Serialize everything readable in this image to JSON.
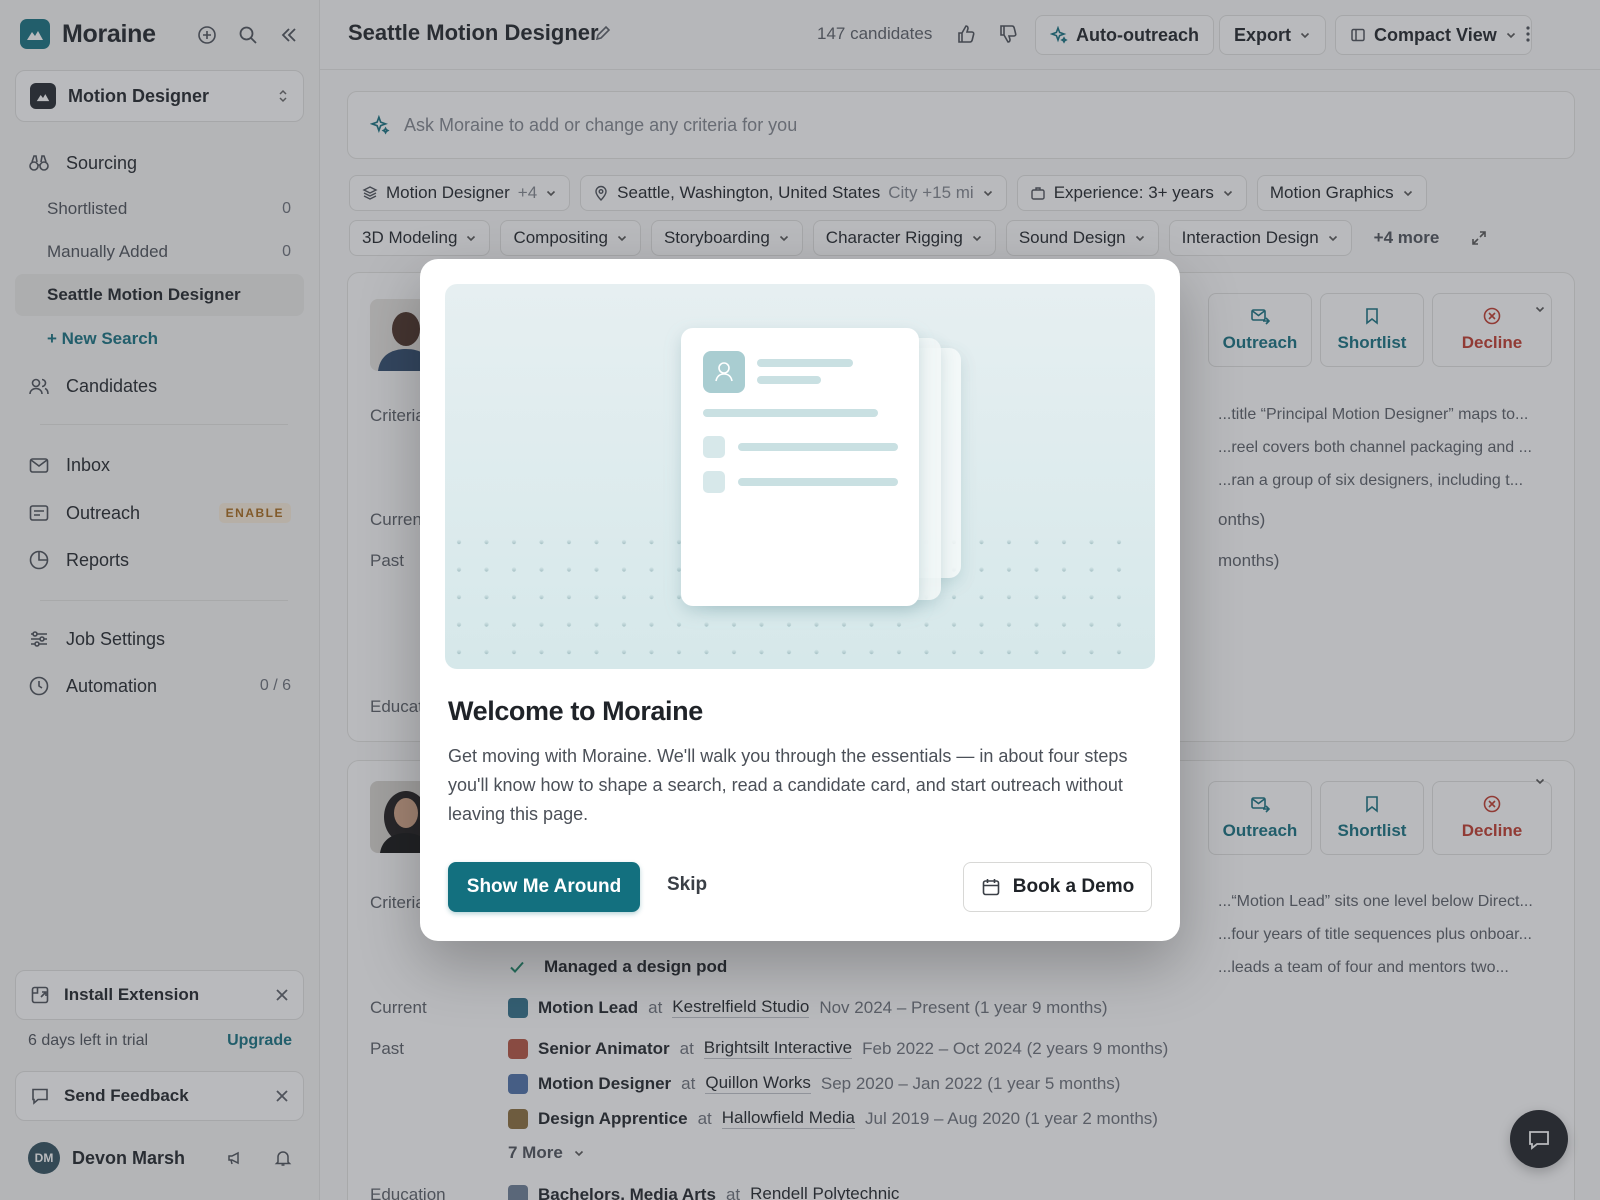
{
  "app": {
    "name": "Moraine"
  },
  "sidebar": {
    "job": "Motion Designer",
    "sourcing": "Sourcing",
    "sub_items": [
      {
        "label": "Shortlisted",
        "count": "0"
      },
      {
        "label": "Manually Added",
        "count": "0"
      },
      {
        "label": "Seattle Motion Designer",
        "count": ""
      }
    ],
    "new_search": "+ New Search",
    "candidates": "Candidates",
    "inbox": "Inbox",
    "outreach": "Outreach",
    "outreach_badge": "ENABLE",
    "reports": "Reports",
    "job_settings": "Job Settings",
    "automation": "Automation",
    "automation_count": "0 / 6",
    "install_extension": "Install Extension",
    "trial_text": "6 days left in trial",
    "upgrade": "Upgrade",
    "send_feedback": "Send Feedback",
    "user": {
      "initials": "DM",
      "name": "Devon Marsh"
    }
  },
  "header": {
    "title": "Seattle Motion Designer",
    "candidate_count": "147 candidates",
    "auto_outreach": "Auto-outreach",
    "export": "Export",
    "view": "Compact View"
  },
  "ask": {
    "placeholder": "Ask Moraine to add or change any criteria for you"
  },
  "filters": {
    "role": {
      "label": "Motion Designer",
      "extra": "+4"
    },
    "location": {
      "label": "Seattle, Washington, United States",
      "extra": "City +15 mi"
    },
    "experience": "Experience: 3+ years",
    "skills": [
      "Motion Graphics",
      "3D Modeling",
      "Compositing",
      "Storyboarding",
      "Character Rigging",
      "Sound Design",
      "Interaction Design"
    ],
    "more": "+4 more"
  },
  "card1": {
    "labels": {
      "criteria": "Criteria",
      "current": "Current",
      "past": "Past",
      "education": "Education"
    },
    "criteria_snippets": [
      "...title “Principal Motion Designer” maps to...",
      "...reel covers both channel packaging and ...",
      "...ran a group of six designers, including t..."
    ],
    "current_tail": "onths)",
    "past_tail": "months)"
  },
  "card2": {
    "labels": {
      "criteria": "Criteria",
      "current": "Current",
      "past": "Past",
      "education": "Education"
    },
    "criteria_snippets": [
      "...“Motion Lead” sits one level below Direct...",
      "...four years of title sequences plus onboar...",
      "...leads a team of four and mentors two..."
    ],
    "criteria_met": "Managed a design pod",
    "current": {
      "role": "Motion Lead",
      "at": "at",
      "company": "Kestrelfield Studio",
      "dates": "Nov 2024 – Present (1 year 9 months)"
    },
    "past": [
      {
        "role": "Senior Animator",
        "at": "at",
        "company": "Brightsilt Interactive",
        "dates": "Feb 2022 – Oct 2024 (2 years 9 months)"
      },
      {
        "role": "Motion Designer",
        "at": "at",
        "company": "Quillon Works",
        "dates": "Sep 2020 – Jan 2022 (1 year 5 months)"
      },
      {
        "role": "Design Apprentice",
        "at": "at",
        "company": "Hallowfield Media",
        "dates": "Jul 2019 – Aug 2020 (1 year 2 months)"
      }
    ],
    "more": "7 More",
    "education": {
      "degree": "Bachelors, Media Arts",
      "at": "at",
      "school": "Rendell Polytechnic"
    }
  },
  "actions": {
    "outreach": "Outreach",
    "shortlist": "Shortlist",
    "decline": "Decline"
  },
  "modal": {
    "title": "Welcome to Moraine",
    "body": "Get moving with Moraine. We'll walk you through the essentials — in about four steps you'll know how to shape a search, read a candidate card, and start outreach without leaving this page.",
    "primary": "Show Me Around",
    "skip": "Skip",
    "demo": "Book a Demo"
  },
  "colors": {
    "accent": "#13707f",
    "decline": "#c0392b",
    "overlay": "rgba(60,64,72,0.36)"
  },
  "icons": [
    "plus-circle-icon",
    "search-icon",
    "collapse-icon",
    "binoculars-icon",
    "users-icon",
    "mail-icon",
    "message-card-icon",
    "clock-pie-icon",
    "sliders-icon",
    "clock-icon",
    "extension-icon",
    "chat-icon",
    "megaphone-icon",
    "bell-icon",
    "pencil-icon",
    "thumbs-up-icon",
    "thumbs-down-icon",
    "sparkle-icon",
    "chevron-down-icon",
    "layout-icon",
    "kebab-icon",
    "layers-icon",
    "pin-icon",
    "briefcase-icon",
    "expand-icon",
    "calendar-icon",
    "bookmark-icon",
    "x-circle-icon",
    "send-mail-icon",
    "check-icon"
  ]
}
